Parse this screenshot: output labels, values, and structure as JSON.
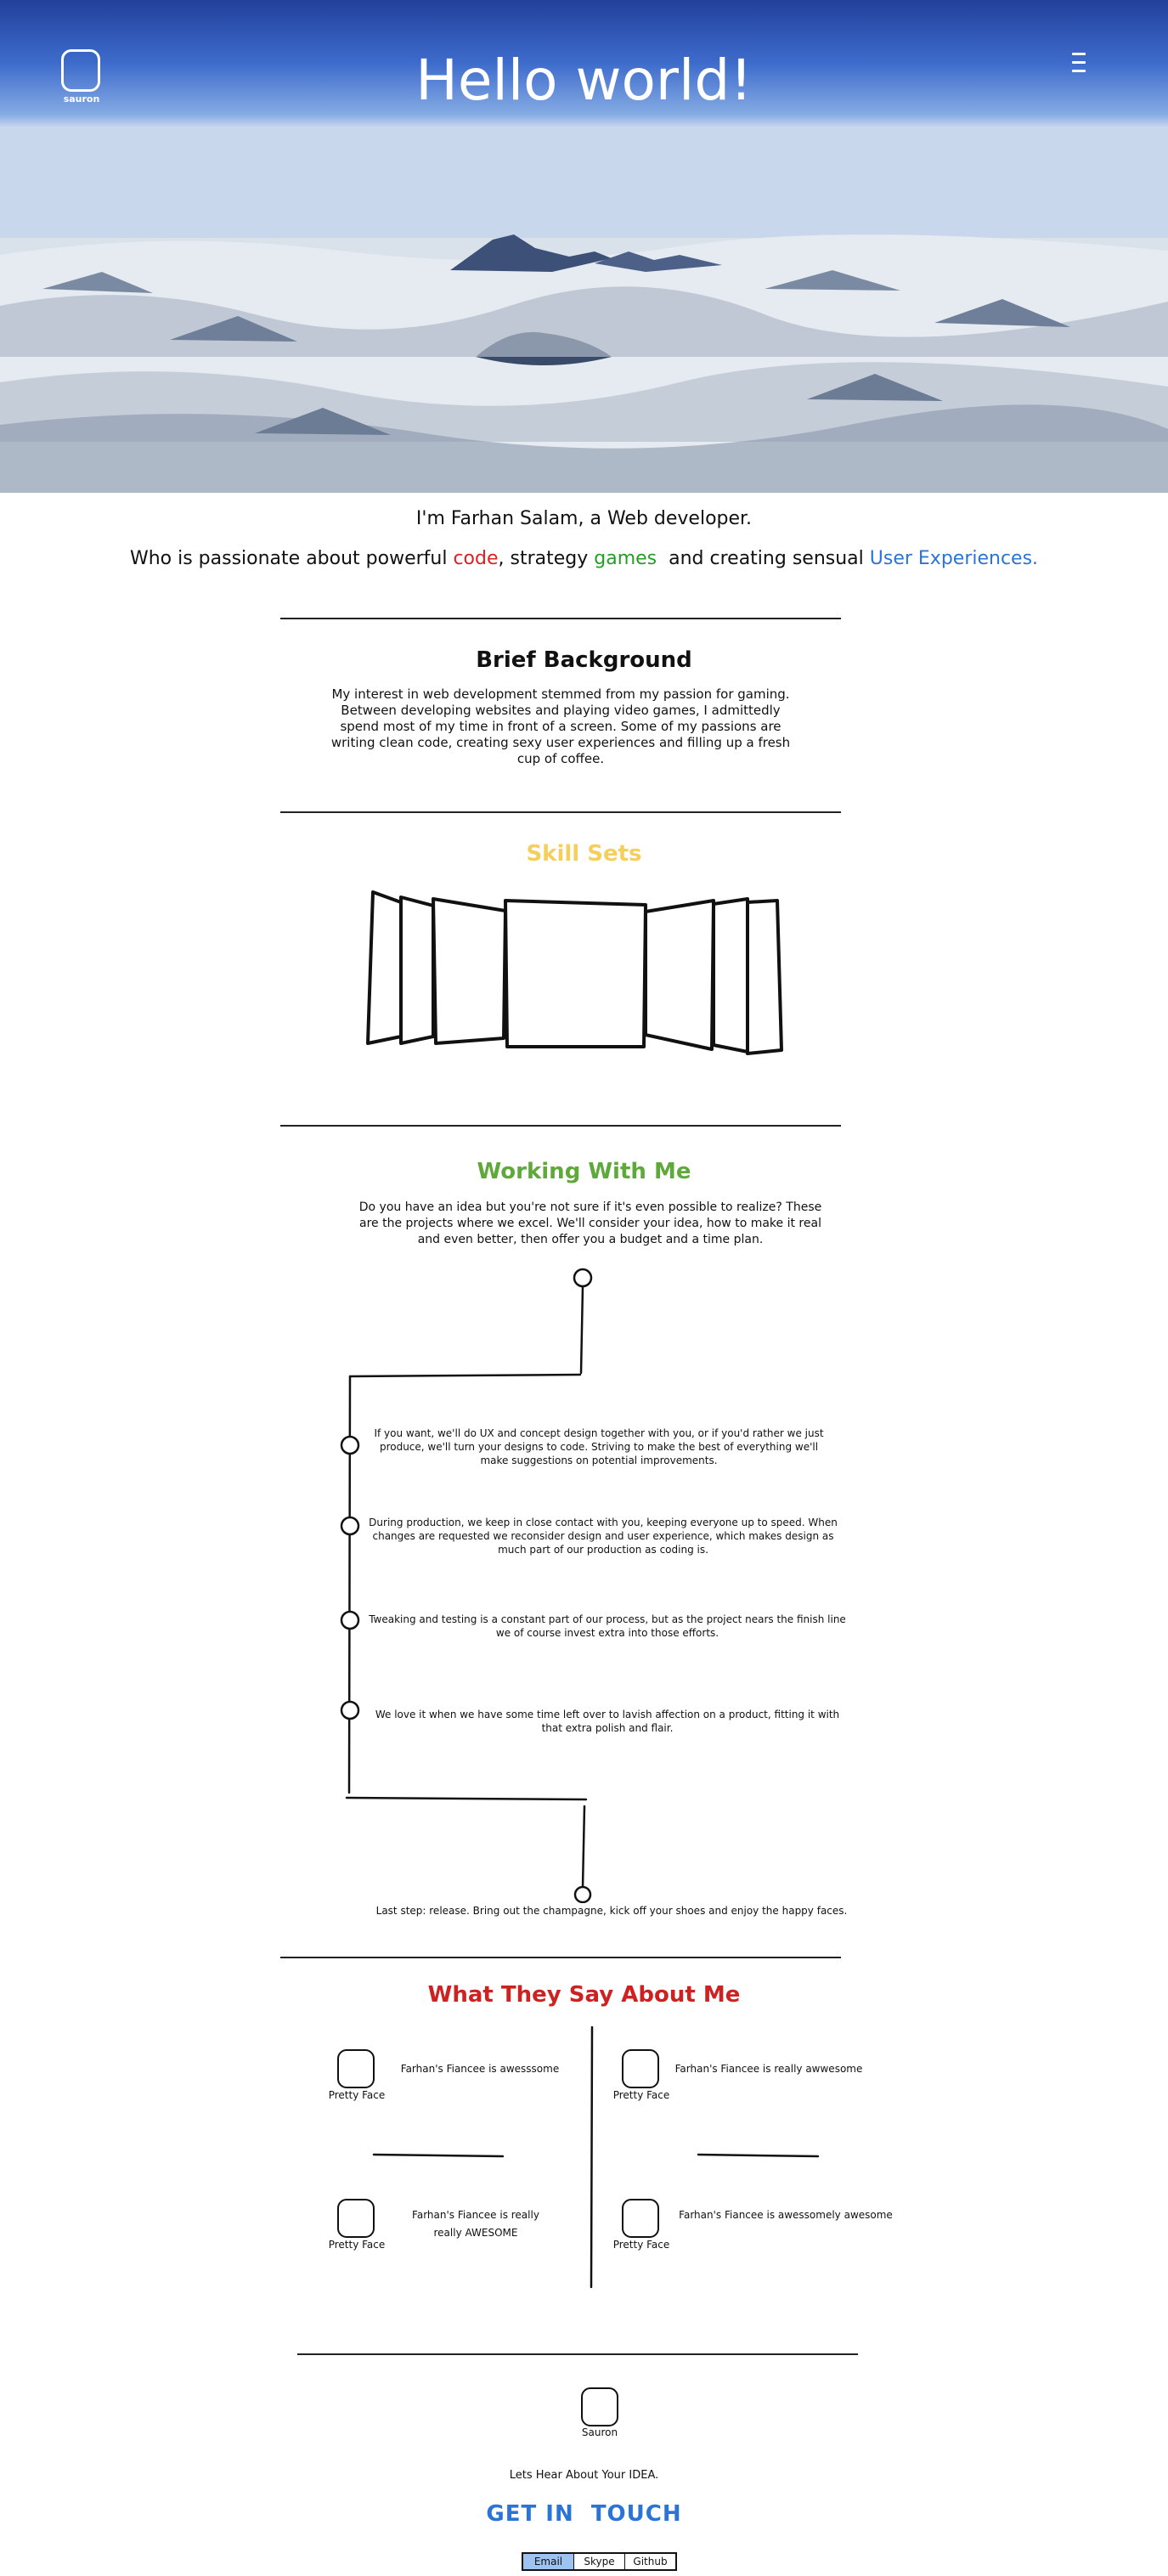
{
  "hero": {
    "title": "Hello world!",
    "logo_text": "sauron"
  },
  "intro": {
    "line1": "I'm Farhan Salam, a Web developer.",
    "line2_a": "Who is passionate about powerful ",
    "line2_code": "code",
    "line2_b": ", strategy ",
    "line2_games": "games",
    "line2_c": "  and creating sensual ",
    "line2_ux": "User Experiences."
  },
  "background": {
    "title": "Brief Background",
    "body": "My interest in web development stemmed from my passion for gaming. Between developing websites and playing video games, I admittedly spend most of my time in front of a screen. Some of my passions are writing clean code, creating sexy user experiences and filling up a fresh cup of coffee."
  },
  "skills": {
    "title": "Skill Sets"
  },
  "working": {
    "title": "Working With Me",
    "body": "Do you have an idea but you're not sure if it's even possible to realize? These are the projects where we excel. We'll consider your idea, how to make it real and even better, then offer you a budget and a time plan.",
    "steps": [
      "If you want, we'll do UX and concept design together with you, or if you'd rather we just produce, we'll turn your designs to code. Striving to make the best of everything we'll make suggestions on potential improvements.",
      "During production, we keep in close contact with you, keeping everyone up to speed. When changes are requested we reconsider design and user experience, which makes design as much part of our production as coding is.",
      "Tweaking and testing is a constant part of our process, but as the project nears the finish line we of course invest extra into those efforts.",
      "We love it when we have some time left over to lavish affection on a product, fitting it with that extra polish and flair."
    ],
    "release": "Last step: release. Bring out the champagne, kick off your shoes and enjoy the happy faces."
  },
  "testimonials": {
    "title": "What They Say About Me",
    "items": [
      {
        "name": "Pretty Face",
        "quote": "Farhan's Fiancee is awesssome"
      },
      {
        "name": "Pretty Face",
        "quote": "Farhan's Fiancee is really awwesome"
      },
      {
        "name": "Pretty Face",
        "quote": "Farhan's Fiancee is really really AWESOME"
      },
      {
        "name": "Pretty Face",
        "quote": "Farhan's Fiancee is awessomely awesome"
      }
    ]
  },
  "footer": {
    "logo_label": "Sauron",
    "lead": "Lets Hear About Your IDEA.",
    "cta": "GET IN  TOUCH",
    "buttons": [
      "Email",
      "Skype",
      "Github"
    ]
  },
  "colors": {
    "skills_title": "#f5cf5c",
    "working_title": "#5fa83a",
    "testimonials_title": "#cc2222",
    "accent_blue": "#2a74d8"
  }
}
